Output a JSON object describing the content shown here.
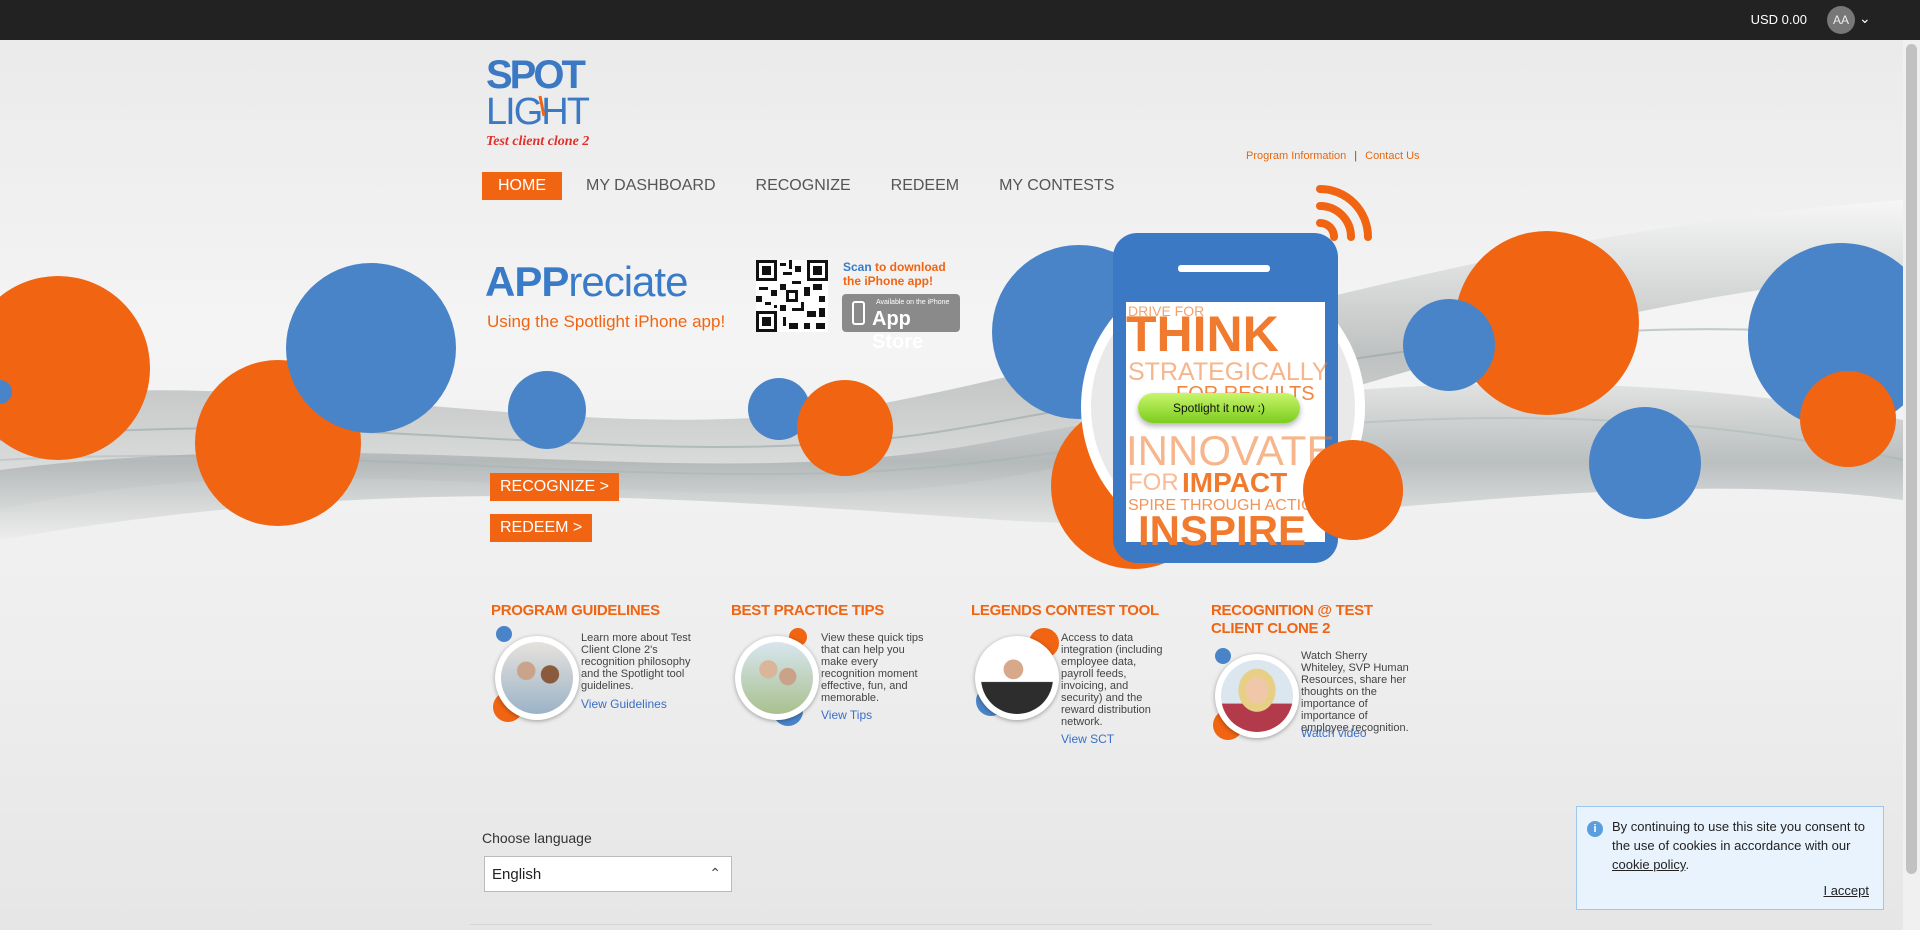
{
  "topbar": {
    "balance": "USD 0.00",
    "avatar_initials": "AA"
  },
  "header": {
    "links": [
      {
        "label": "Program Information"
      },
      {
        "label": "Contact Us"
      }
    ],
    "logo": {
      "line1": "SPOT",
      "line2": "LIGHT",
      "tagline": "Test client clone 2"
    }
  },
  "nav": [
    {
      "label": "HOME",
      "active": true
    },
    {
      "label": "MY DASHBOARD"
    },
    {
      "label": "RECOGNIZE"
    },
    {
      "label": "REDEEM"
    },
    {
      "label": "MY CONTESTS"
    }
  ],
  "hero": {
    "title_bold": "APP",
    "title_rest": "reciate",
    "subtitle": "Using the Spotlight iPhone app!",
    "scan_word": "Scan",
    "scan_rest": " to download",
    "scan_line2": "the iPhone app!",
    "appstore_small": "Available on the iPhone",
    "appstore_big": "App Store",
    "btn_recognize": "RECOGNIZE >",
    "btn_redeem": "REDEEM >",
    "phone_pill": "Spotlight it now :)",
    "phone_words": [
      "DRIVE FOR",
      "THINK",
      "STRATEGICALLY",
      "FOR RESULTS",
      "INNOVATE",
      "FOR IMPACT",
      "SPIRE THROUGH ACTION",
      "INSPIRE"
    ]
  },
  "features": [
    {
      "title": "PROGRAM GUIDELINES",
      "desc": "Learn more about Test Client Clone 2's recognition philosophy and the Spotlight tool guidelines.",
      "link": "View Guidelines"
    },
    {
      "title": "BEST PRACTICE TIPS",
      "desc": "View these quick tips that can help you make every recognition moment effective, fun, and memorable.",
      "link": "View Tips"
    },
    {
      "title": "LEGENDS CONTEST TOOL",
      "desc": "Access to data integration (including employee data, payroll feeds, invoicing, and security) and the reward distribution network.",
      "link": "View SCT"
    },
    {
      "title": "RECOGNITION @ TEST CLIENT CLONE 2",
      "desc": "Watch Sherry Whiteley, SVP Human Resources, share her thoughts on the importance of importance of employee recognition.",
      "link": "Watch video"
    }
  ],
  "language": {
    "label": "Choose language",
    "selected": "English"
  },
  "cookie": {
    "text_before": "By continuing to use this site you consent to the use of cookies in accordance with our ",
    "policy_link": "cookie policy",
    "text_after": ".",
    "accept": "I accept"
  },
  "colors": {
    "orange": "#f06412",
    "blue": "#3a7bc8",
    "topbar": "#222222"
  }
}
